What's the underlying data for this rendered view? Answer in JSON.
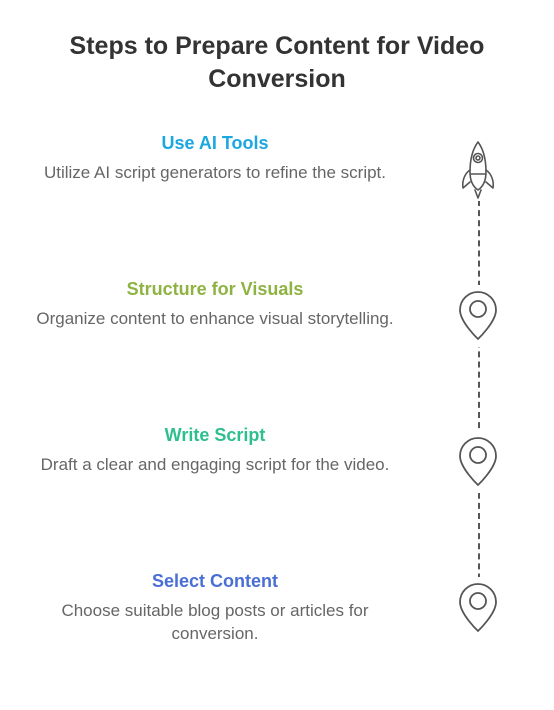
{
  "title": "Steps to Prepare Content for Video Conversion",
  "steps": [
    {
      "title": "Use AI Tools",
      "desc": "Utilize AI script generators to refine the script.",
      "color": "#1ba7e0",
      "icon": "rocket"
    },
    {
      "title": "Structure for Visuals",
      "desc": "Organize content to enhance visual storytelling.",
      "color": "#8fb342",
      "icon": "pin"
    },
    {
      "title": "Write Script",
      "desc": "Draft a clear and engaging script for the video.",
      "color": "#2ebf8f",
      "icon": "pin"
    },
    {
      "title": "Select Content",
      "desc": "Choose suitable blog posts or articles for conversion.",
      "color": "#4a6fd4",
      "icon": "pin"
    }
  ]
}
